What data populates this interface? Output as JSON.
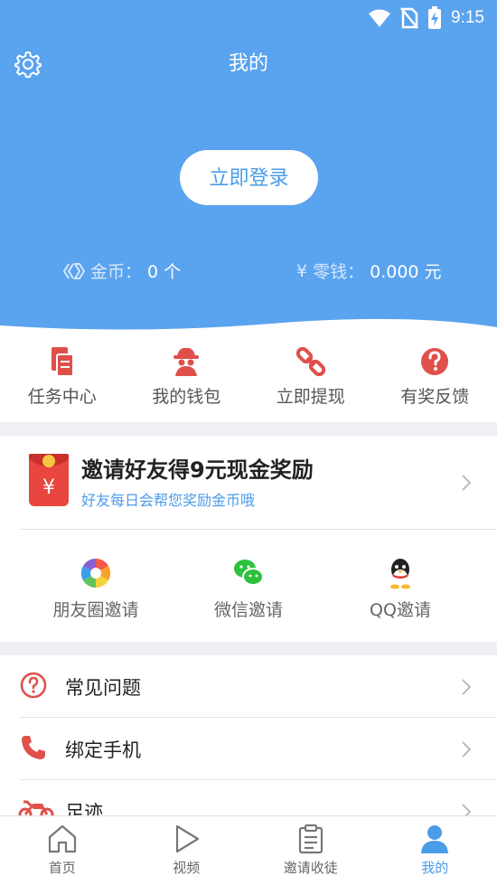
{
  "status_bar": {
    "time": "9:15"
  },
  "header": {
    "title": "我的",
    "login_label": "立即登录",
    "coins_label": "金币：",
    "coins_value": "0 个",
    "money_label": "零钱：",
    "money_value": "0.000 元",
    "money_symbol": "¥"
  },
  "quick_actions": [
    {
      "label": "任务中心",
      "icon": "task-center-icon"
    },
    {
      "label": "我的钱包",
      "icon": "wallet-icon"
    },
    {
      "label": "立即提现",
      "icon": "link-icon"
    },
    {
      "label": "有奖反馈",
      "icon": "question-icon"
    }
  ],
  "invite": {
    "title": "邀请好友得9元现金奖励",
    "subtitle": "好友每日会帮您奖励金币哦",
    "redpacket_symbol": "¥",
    "share": [
      {
        "label": "朋友圈邀请",
        "icon": "moments-icon"
      },
      {
        "label": "微信邀请",
        "icon": "wechat-icon"
      },
      {
        "label": "QQ邀请",
        "icon": "qq-icon"
      }
    ]
  },
  "menu": [
    {
      "label": "常见问题",
      "icon": "faq-icon"
    },
    {
      "label": "绑定手机",
      "icon": "phone-icon"
    },
    {
      "label": "足迹",
      "icon": "motorcycle-icon"
    }
  ],
  "bottom_nav": [
    {
      "label": "首页",
      "icon": "home-icon"
    },
    {
      "label": "视频",
      "icon": "play-icon"
    },
    {
      "label": "邀请收徒",
      "icon": "clipboard-icon"
    },
    {
      "label": "我的",
      "icon": "user-icon",
      "active": true
    }
  ],
  "colors": {
    "header_bg": "#5aa3ef",
    "accent": "#4a9be8",
    "icon_red": "#e0504a"
  }
}
